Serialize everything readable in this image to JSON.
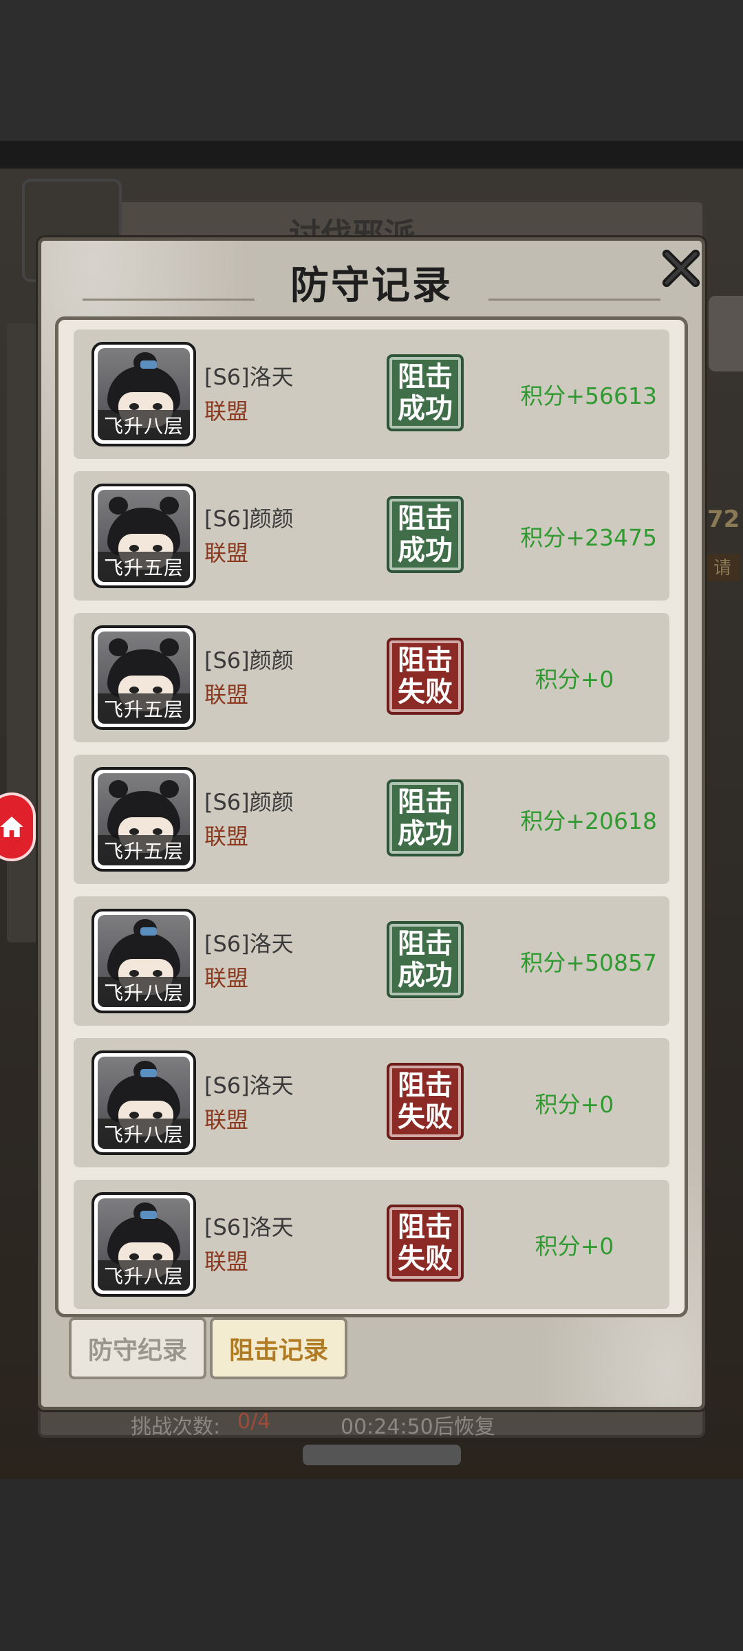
{
  "background": {
    "title": "讨伐邪派",
    "side_text_1": "72",
    "side_text_2": "请",
    "challenge_label": "挑战次数:",
    "challenge_value": "0/4",
    "timer_text": "00:24:50后恢复"
  },
  "modal": {
    "title": "防守记录",
    "close_icon": "close-icon"
  },
  "records": [
    {
      "name": "[S6]洛天",
      "guild": "联盟",
      "rank": "飞升八层",
      "result_line1": "阻击",
      "result_line2": "成功",
      "result": "success",
      "score": "积分+56613",
      "avatar": "boy"
    },
    {
      "name": "[S6]颜颜",
      "guild": "联盟",
      "rank": "飞升五层",
      "result_line1": "阻击",
      "result_line2": "成功",
      "result": "success",
      "score": "积分+23475",
      "avatar": "girl"
    },
    {
      "name": "[S6]颜颜",
      "guild": "联盟",
      "rank": "飞升五层",
      "result_line1": "阻击",
      "result_line2": "失败",
      "result": "fail",
      "score": "积分+0",
      "avatar": "girl"
    },
    {
      "name": "[S6]颜颜",
      "guild": "联盟",
      "rank": "飞升五层",
      "result_line1": "阻击",
      "result_line2": "成功",
      "result": "success",
      "score": "积分+20618",
      "avatar": "girl"
    },
    {
      "name": "[S6]洛天",
      "guild": "联盟",
      "rank": "飞升八层",
      "result_line1": "阻击",
      "result_line2": "成功",
      "result": "success",
      "score": "积分+50857",
      "avatar": "boy"
    },
    {
      "name": "[S6]洛天",
      "guild": "联盟",
      "rank": "飞升八层",
      "result_line1": "阻击",
      "result_line2": "失败",
      "result": "fail",
      "score": "积分+0",
      "avatar": "boy"
    },
    {
      "name": "[S6]洛天",
      "guild": "联盟",
      "rank": "飞升八层",
      "result_line1": "阻击",
      "result_line2": "失败",
      "result": "fail",
      "score": "积分+0",
      "avatar": "boy"
    }
  ],
  "tabs": {
    "defend_label": "防守纪录",
    "block_label": "阻击记录",
    "active": "block"
  },
  "colors": {
    "success": "#3f6e48",
    "fail": "#8c2a25",
    "score_green": "#2f9a2f",
    "guild_brown": "#8b3a1f"
  }
}
